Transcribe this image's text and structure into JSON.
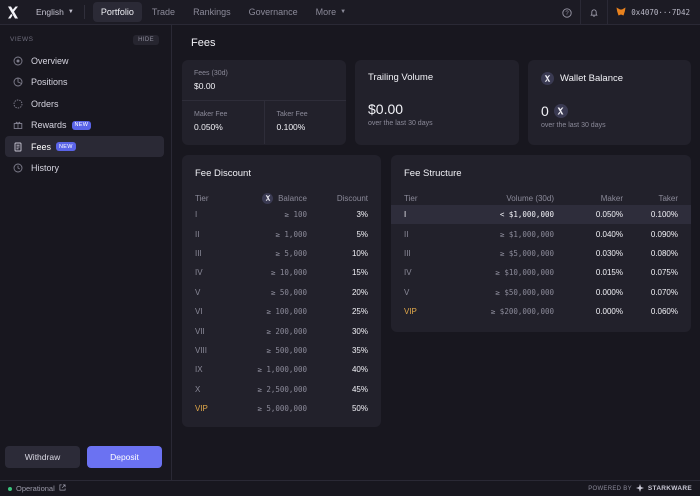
{
  "topbar": {
    "language": "English",
    "nav": [
      {
        "label": "Portfolio",
        "active": true
      },
      {
        "label": "Trade",
        "active": false
      },
      {
        "label": "Rankings",
        "active": false
      },
      {
        "label": "Governance",
        "active": false
      },
      {
        "label": "More",
        "active": false
      }
    ],
    "address": "0x4070···7D42"
  },
  "sidebar": {
    "section_label": "VIEWS",
    "hide_label": "HIDE",
    "items": [
      {
        "label": "Overview",
        "icon": "overview-icon",
        "badge": ""
      },
      {
        "label": "Positions",
        "icon": "positions-icon",
        "badge": ""
      },
      {
        "label": "Orders",
        "icon": "orders-icon",
        "badge": ""
      },
      {
        "label": "Rewards",
        "icon": "rewards-icon",
        "badge": "NEW"
      },
      {
        "label": "Fees",
        "icon": "fees-icon",
        "badge": "NEW"
      },
      {
        "label": "History",
        "icon": "history-icon",
        "badge": ""
      }
    ],
    "withdraw_label": "Withdraw",
    "deposit_label": "Deposit"
  },
  "page": {
    "title": "Fees"
  },
  "fees_card": {
    "fees30_label": "Fees (30d)",
    "fees30_value": "$0.00",
    "maker_label": "Maker Fee",
    "maker_value": "0.050%",
    "taker_label": "Taker Fee",
    "taker_value": "0.100%"
  },
  "volume_card": {
    "title": "Trailing Volume",
    "value": "$0.00",
    "sub": "over the last 30 days"
  },
  "wallet_card": {
    "title": "Wallet Balance",
    "value": "0",
    "sub": "over the last 30 days"
  },
  "fee_discount": {
    "title": "Fee Discount",
    "headers": {
      "tier": "Tier",
      "balance": "Balance",
      "discount": "Discount"
    },
    "rows": [
      {
        "tier": "I",
        "balance": "≥ 100",
        "discount": "3%"
      },
      {
        "tier": "II",
        "balance": "≥ 1,000",
        "discount": "5%"
      },
      {
        "tier": "III",
        "balance": "≥ 5,000",
        "discount": "10%"
      },
      {
        "tier": "IV",
        "balance": "≥ 10,000",
        "discount": "15%"
      },
      {
        "tier": "V",
        "balance": "≥ 50,000",
        "discount": "20%"
      },
      {
        "tier": "VI",
        "balance": "≥ 100,000",
        "discount": "25%"
      },
      {
        "tier": "VII",
        "balance": "≥ 200,000",
        "discount": "30%"
      },
      {
        "tier": "VIII",
        "balance": "≥ 500,000",
        "discount": "35%"
      },
      {
        "tier": "IX",
        "balance": "≥ 1,000,000",
        "discount": "40%"
      },
      {
        "tier": "X",
        "balance": "≥ 2,500,000",
        "discount": "45%"
      },
      {
        "tier": "VIP",
        "balance": "≥ 5,000,000",
        "discount": "50%"
      }
    ]
  },
  "fee_structure": {
    "title": "Fee Structure",
    "headers": {
      "tier": "Tier",
      "volume": "Volume (30d)",
      "maker": "Maker",
      "taker": "Taker"
    },
    "rows": [
      {
        "tier": "I",
        "volume": "< $1,000,000",
        "maker": "0.050%",
        "taker": "0.100%"
      },
      {
        "tier": "II",
        "volume": "≥ $1,000,000",
        "maker": "0.040%",
        "taker": "0.090%"
      },
      {
        "tier": "III",
        "volume": "≥ $5,000,000",
        "maker": "0.030%",
        "taker": "0.080%"
      },
      {
        "tier": "IV",
        "volume": "≥ $10,000,000",
        "maker": "0.015%",
        "taker": "0.075%"
      },
      {
        "tier": "V",
        "volume": "≥ $50,000,000",
        "maker": "0.000%",
        "taker": "0.070%"
      },
      {
        "tier": "VIP",
        "volume": "≥ $200,000,000",
        "maker": "0.000%",
        "taker": "0.060%"
      }
    ]
  },
  "footer": {
    "status": "Operational",
    "powered_by": "POWERED BY",
    "brand": "STARKWARE"
  },
  "colors": {
    "accent": "#6b72f2",
    "vip": "#e3a94a",
    "status_ok": "#3ac47d"
  }
}
